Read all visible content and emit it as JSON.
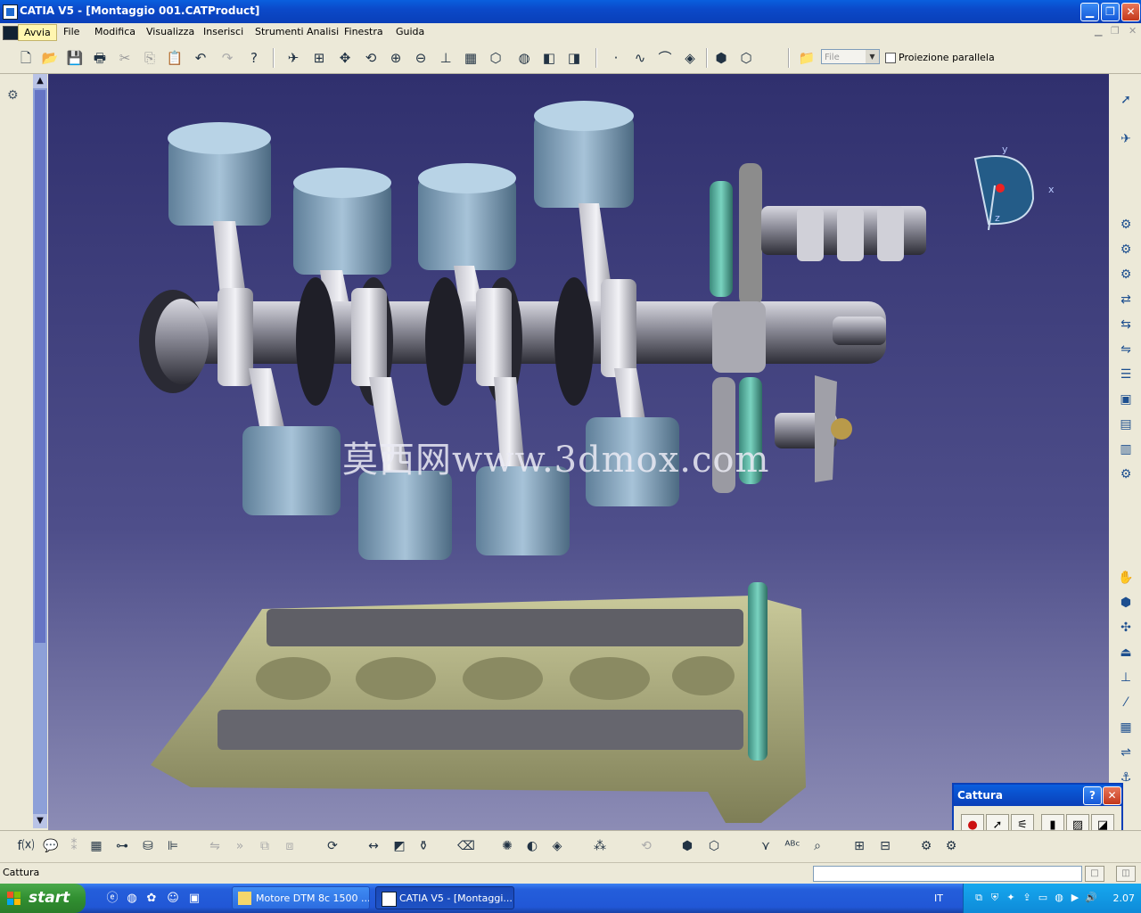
{
  "window": {
    "title": "CATIA V5 - [Montaggio 001.CATProduct]",
    "min": "▁",
    "restore": "❐",
    "close": "✕"
  },
  "menu": {
    "items": [
      "Avvia",
      "File",
      "Modifica",
      "Visualizza",
      "Inserisci",
      "Strumenti",
      "Analisi",
      "Finestra",
      "Guida"
    ],
    "doc_min": "▁",
    "doc_restore": "❐",
    "doc_close": "✕"
  },
  "toolbar": {
    "file_select_value": "File",
    "projection_label": "Proiezione parallela"
  },
  "viewport": {
    "watermark": "莫西网www.3dmox.com",
    "compass": {
      "x": "x",
      "y": "y",
      "z": "z"
    },
    "colors": {
      "background_top": "#30306e",
      "background_bottom": "#8c8cb5",
      "piston": "#8fb2cc",
      "head": "#a8a878",
      "gear": "#4fb0a0"
    }
  },
  "cattura": {
    "title": "Cattura",
    "help": "?",
    "close": "✕"
  },
  "status": {
    "text": "Cattura"
  },
  "taskbar": {
    "start": "start",
    "tasks": [
      {
        "label": "Motore DTM 8c 1500 ...",
        "active": false
      },
      {
        "label": "CATIA V5 - [Montaggi...",
        "active": true
      }
    ],
    "language": "IT",
    "clock": "2.07"
  },
  "icons": {
    "toolbar": [
      "new-icon",
      "open-icon",
      "save-icon",
      "print-icon",
      "cut-icon",
      "copy-icon",
      "paste-icon",
      "undo-icon",
      "redo-icon",
      "whats-this-icon",
      "fly-icon",
      "fit-all-icon",
      "pan-icon",
      "rotate-icon",
      "zoom-in-icon",
      "zoom-out-icon",
      "normal-view-icon",
      "multi-view-icon",
      "iso-view-icon",
      "shading-icon",
      "hide-show-icon",
      "swap-space-icon"
    ]
  }
}
